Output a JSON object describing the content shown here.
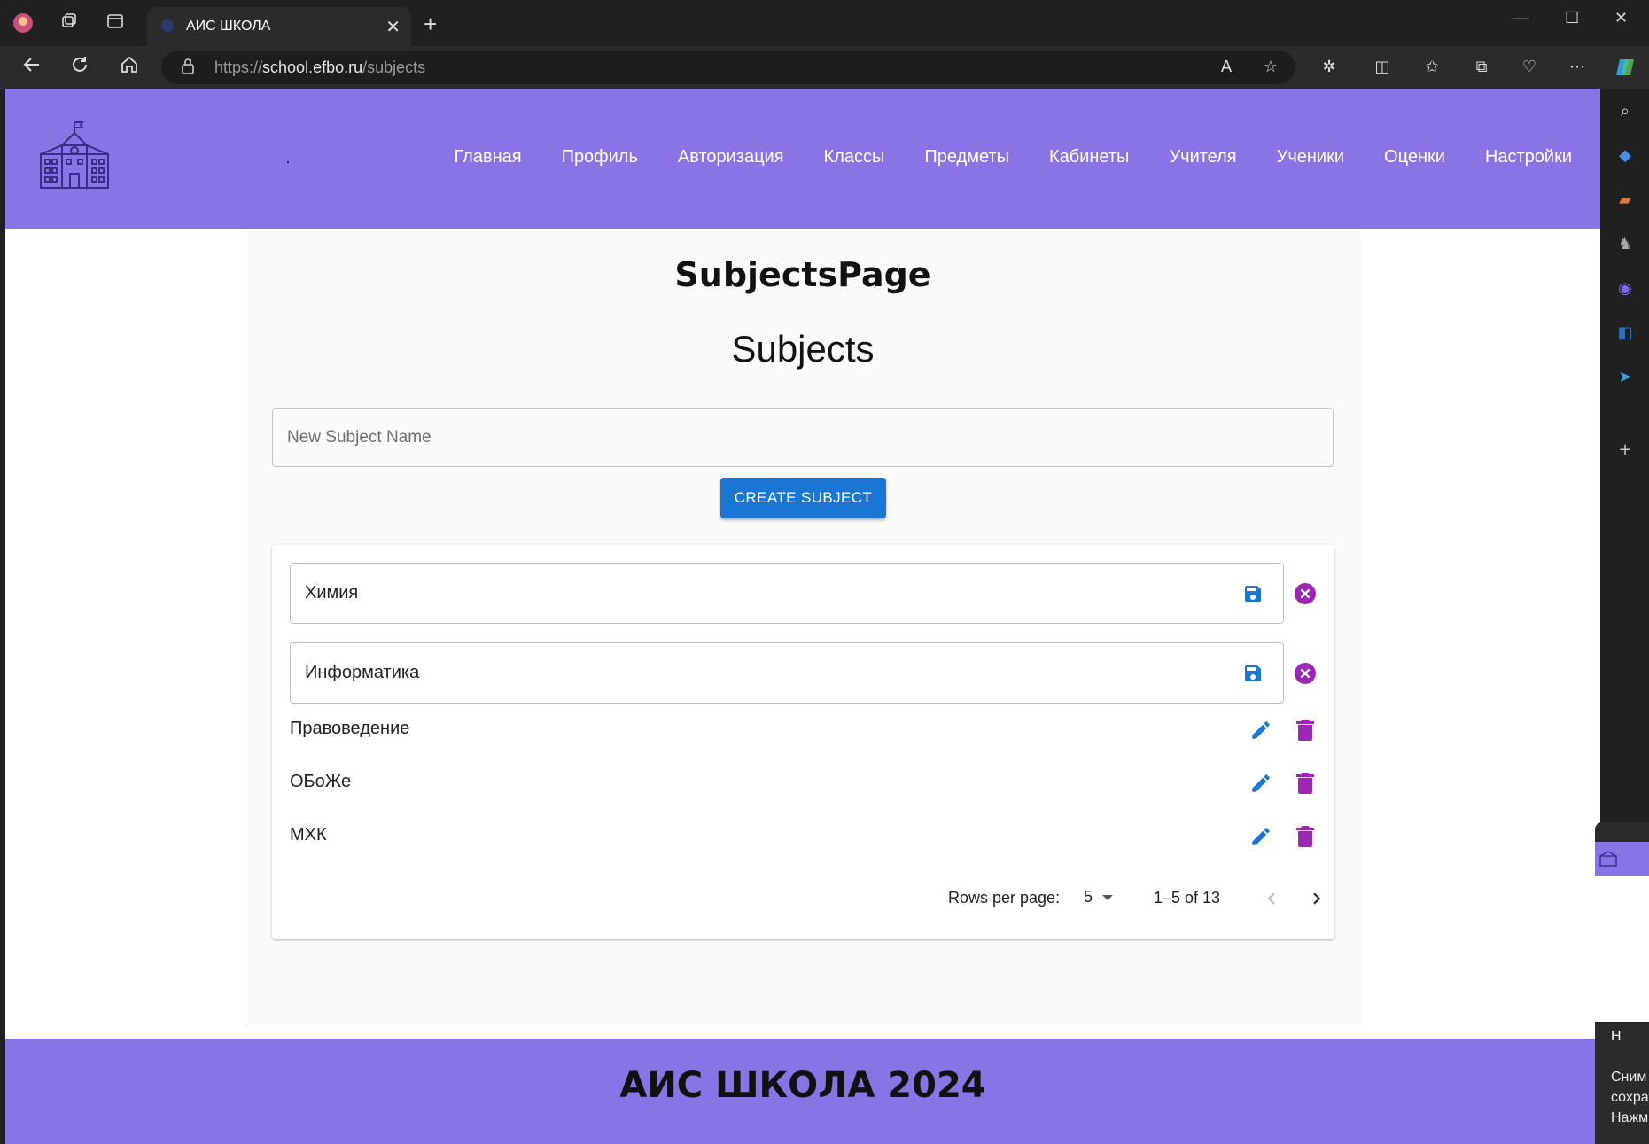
{
  "browser": {
    "tab_title": "АИС ШКОЛА",
    "url_scheme": "https://",
    "url_host": "school.efbo.ru",
    "url_path": "/subjects"
  },
  "header": {
    "nav": [
      "Главная",
      "Профиль",
      "Авторизация",
      "Классы",
      "Предметы",
      "Кабинеты",
      "Учителя",
      "Ученики",
      "Оценки",
      "Настройки"
    ]
  },
  "page": {
    "title": "SubjectsPage",
    "subtitle": "Subjects",
    "new_subject_placeholder": "New Subject Name",
    "create_button": "CREATE SUBJECT"
  },
  "subjects": {
    "editing": [
      {
        "value": "Химия"
      },
      {
        "value": "Информатика"
      }
    ],
    "rows": [
      {
        "label": "Правоведение"
      },
      {
        "label": "ОБоЖе"
      },
      {
        "label": "МХК"
      }
    ]
  },
  "pagination": {
    "rows_per_page_label": "Rows per page:",
    "rows_per_page_value": "5",
    "range": "1–5 of 13"
  },
  "footer": {
    "text": "АИС ШКОЛА 2024"
  },
  "notification": {
    "line1": "Н",
    "line2": "Сним",
    "line3": "сохра",
    "line4": "Нажм"
  },
  "colors": {
    "header_bg": "#8874e4",
    "primary": "#1976d2",
    "danger": "#9c27b0"
  }
}
